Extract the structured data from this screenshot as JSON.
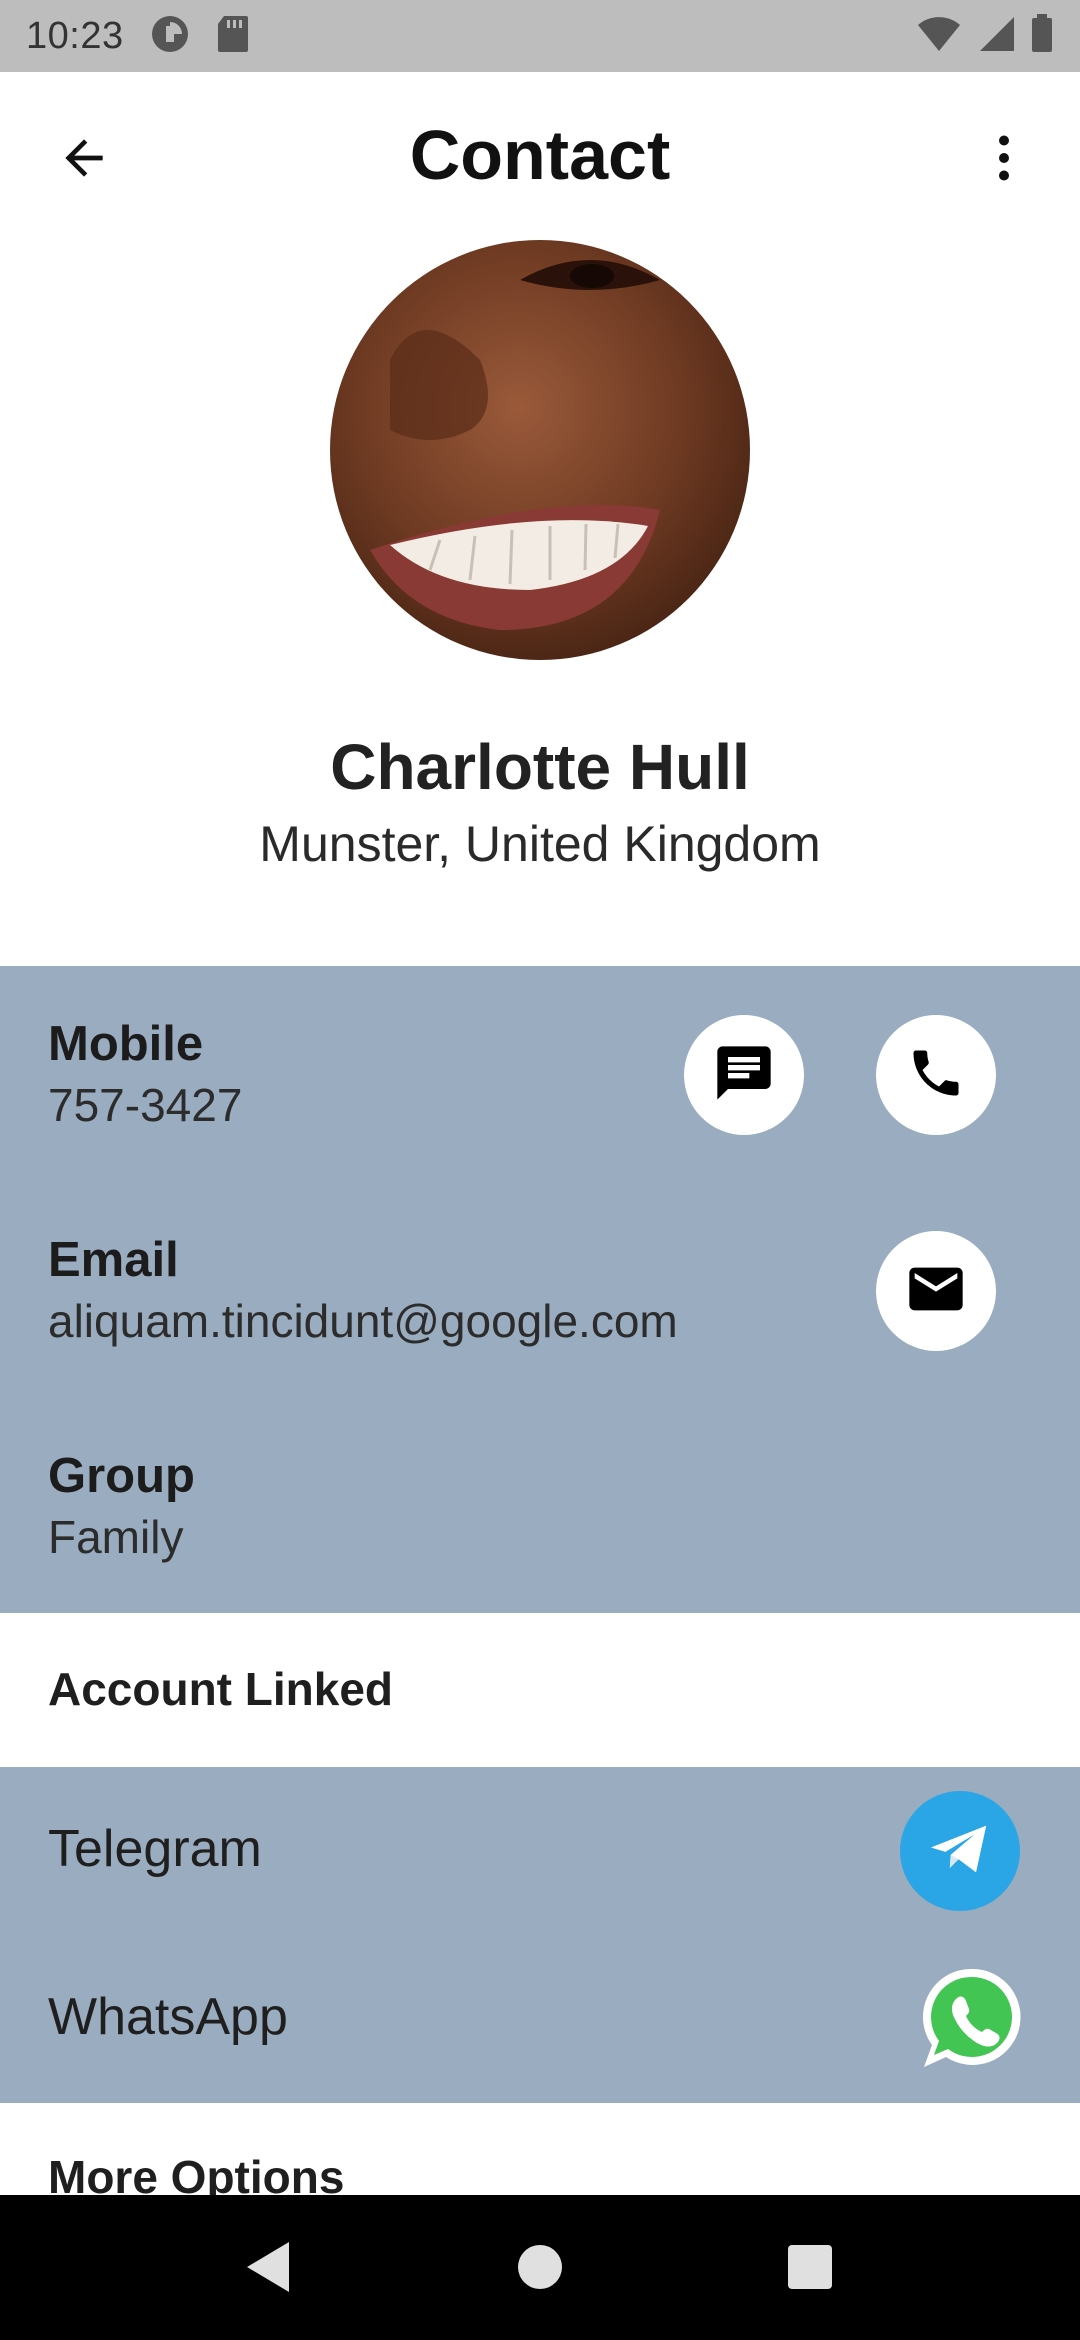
{
  "status_bar": {
    "time": "10:23"
  },
  "app_bar": {
    "title": "Contact",
    "back_icon": "arrow-left-icon",
    "more_icon": "more-vert-icon"
  },
  "profile": {
    "name": "Charlotte Hull",
    "location": "Munster, United Kingdom"
  },
  "details": {
    "mobile": {
      "label": "Mobile",
      "value": "757-3427"
    },
    "email": {
      "label": "Email",
      "value": "aliquam.tincidunt@google.com"
    },
    "group": {
      "label": "Group",
      "value": "Family"
    }
  },
  "accounts_section": {
    "header": "Account Linked",
    "items": [
      {
        "label": "Telegram",
        "icon": "telegram-icon"
      },
      {
        "label": "WhatsApp",
        "icon": "whatsapp-icon"
      }
    ]
  },
  "more_options": {
    "header": "More Options"
  },
  "colors": {
    "panel": "#9aacbf",
    "telegram": "#2aa5e6",
    "whatsapp": "#43c553",
    "status_bar": "#bdbdbd"
  }
}
